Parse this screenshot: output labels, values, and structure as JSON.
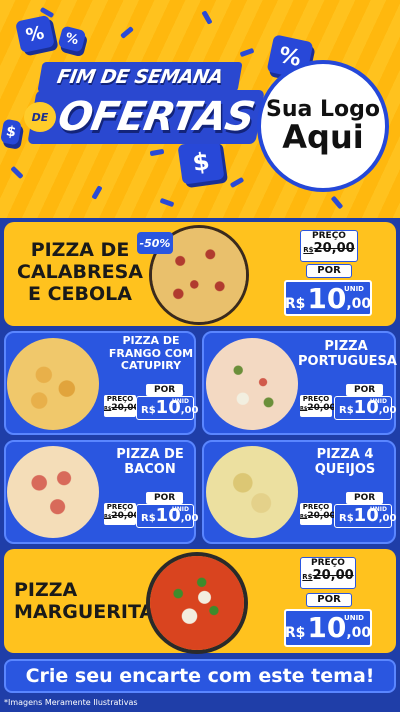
{
  "header": {
    "title_top": "FIM DE SEMANA",
    "title_connector": "DE",
    "title_main": "OFERTAS",
    "logo_line1": "Sua Logo",
    "logo_line2": "Aqui",
    "percent_symbol": "%",
    "dollar_symbol": "$"
  },
  "featured": [
    {
      "name_line1": "PIZZA DE",
      "name_line2": "CALABRESA",
      "name_line3": "E CEBOLA",
      "discount": "-50%",
      "price_label": "PREÇO",
      "old_currency": "R$",
      "old_price": "20,00",
      "por_label": "POR",
      "currency": "R$",
      "price_int": "10",
      "price_dec": ",00",
      "unit": "UNID"
    },
    {
      "name_line1": "PIZZA",
      "name_line2": "MARGUERITA",
      "price_label": "PREÇO",
      "old_currency": "R$",
      "old_price": "20,00",
      "por_label": "POR",
      "currency": "R$",
      "price_int": "10",
      "price_dec": ",00",
      "unit": "UNID"
    }
  ],
  "grid": [
    {
      "name_line1": "PIZZA DE",
      "name_line2": "FRANGO COM",
      "name_line3": "CATUPIRY",
      "price_label": "PREÇO",
      "old_currency": "R$",
      "old_price": "20,00",
      "por_label": "POR",
      "currency": "R$",
      "price_int": "10",
      "price_dec": ",00",
      "unit": "UNID"
    },
    {
      "name_line1": "PIZZA",
      "name_line2": "PORTUGUESA",
      "price_label": "PREÇO",
      "old_currency": "R$",
      "old_price": "20,00",
      "por_label": "POR",
      "currency": "R$",
      "price_int": "10",
      "price_dec": ",00",
      "unit": "UNID"
    },
    {
      "name_line1": "PIZZA DE",
      "name_line2": "BACON",
      "price_label": "PREÇO",
      "old_currency": "R$",
      "old_price": "20,00",
      "por_label": "POR",
      "currency": "R$",
      "price_int": "10",
      "price_dec": ",00",
      "unit": "UNID"
    },
    {
      "name_line1": "PIZZA 4",
      "name_line2": "QUEIJOS",
      "price_label": "PREÇO",
      "old_currency": "R$",
      "old_price": "20,00",
      "por_label": "POR",
      "currency": "R$",
      "price_int": "10",
      "price_dec": ",00",
      "unit": "UNID"
    }
  ],
  "cta": "Crie seu encarte com este tema!",
  "footer_note": "*Imagens Meramente Ilustrativas",
  "colors": {
    "yellow": "#ffc21e",
    "blue": "#2a56e0",
    "navy": "#1f3ea8"
  },
  "icons": [
    "percent-box-icon",
    "dollar-box-icon",
    "confetti-icon"
  ]
}
